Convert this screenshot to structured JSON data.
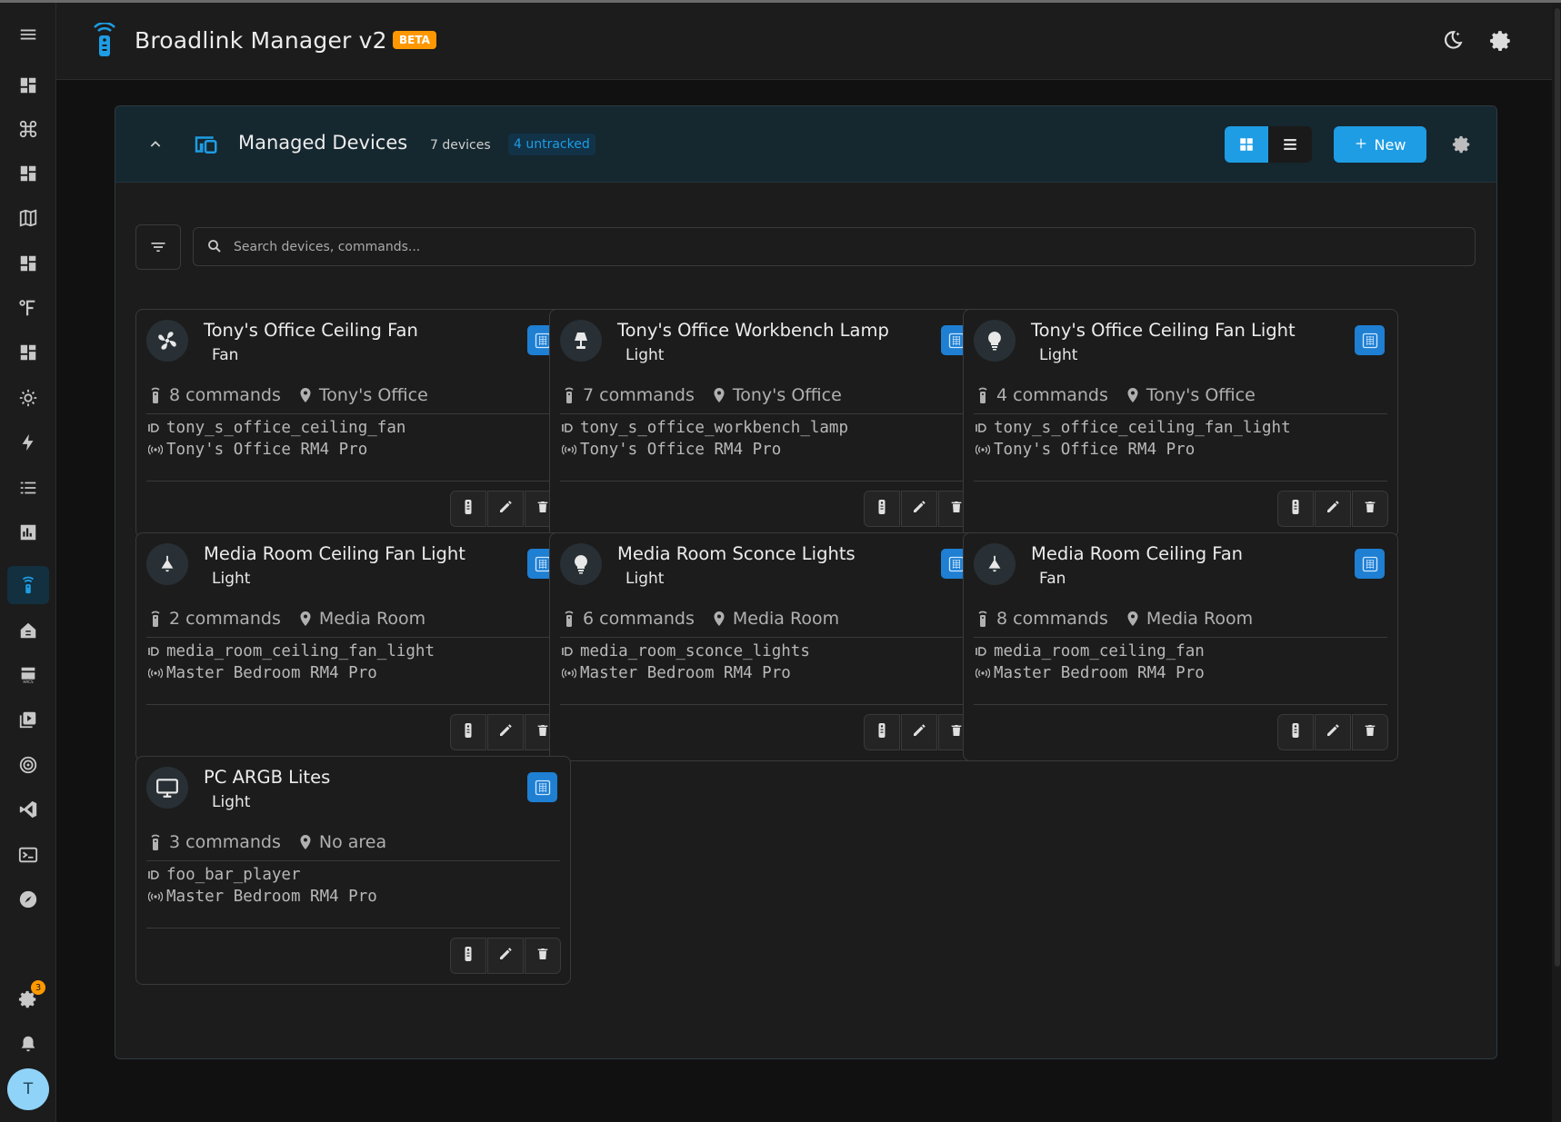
{
  "header": {
    "title": "Broadlink Manager v2",
    "beta_badge": "BETA"
  },
  "sidebar": {
    "items": [
      {
        "icon": "menu-icon"
      },
      {
        "icon": "dashboard-icon"
      },
      {
        "icon": "command-icon"
      },
      {
        "icon": "dashboard-icon"
      },
      {
        "icon": "map-icon"
      },
      {
        "icon": "dashboard-icon"
      },
      {
        "icon": "fahrenheit-icon"
      },
      {
        "icon": "dashboard-icon"
      },
      {
        "icon": "sun-icon"
      },
      {
        "icon": "lightning-icon"
      },
      {
        "icon": "list-icon"
      },
      {
        "icon": "bar-chart-icon"
      },
      {
        "icon": "remote-icon",
        "active": true
      },
      {
        "icon": "house-icon"
      },
      {
        "icon": "hacs-icon"
      },
      {
        "icon": "media-icon"
      },
      {
        "icon": "radar-icon"
      },
      {
        "icon": "vscode-icon"
      },
      {
        "icon": "terminal-icon"
      },
      {
        "icon": "compass-icon"
      }
    ],
    "settings_badge": "3",
    "avatar_initial": "T"
  },
  "panel": {
    "title": "Managed Devices",
    "device_count": "7 devices",
    "untracked_badge": "4 untracked",
    "new_button": "New",
    "view_mode": "grid",
    "search_placeholder": "Search devices, commands..."
  },
  "devices": [
    {
      "name": "Tony's Office Ceiling Fan",
      "type": "Fan",
      "icon": "fan-icon",
      "commands": "8 commands",
      "area": "Tony's Office",
      "entity": "tony_s_office_ceiling_fan",
      "remote": "Tony's Office RM4 Pro"
    },
    {
      "name": "Tony's Office Workbench Lamp",
      "type": "Light",
      "icon": "lamp-icon",
      "commands": "7 commands",
      "area": "Tony's Office",
      "entity": "tony_s_office_workbench_lamp",
      "remote": "Tony's Office RM4 Pro"
    },
    {
      "name": "Tony's Office Ceiling Fan Light",
      "type": "Light",
      "icon": "lightbulb-icon",
      "commands": "4 commands",
      "area": "Tony's Office",
      "entity": "tony_s_office_ceiling_fan_light",
      "remote": "Tony's Office RM4 Pro"
    },
    {
      "name": "Media Room Ceiling Fan Light",
      "type": "Light",
      "icon": "ceiling-light-icon",
      "commands": "2 commands",
      "area": "Media Room",
      "entity": "media_room_ceiling_fan_light",
      "remote": "Master Bedroom RM4 Pro"
    },
    {
      "name": "Media Room Sconce Lights",
      "type": "Light",
      "icon": "lightbulb-icon",
      "commands": "6 commands",
      "area": "Media Room",
      "entity": "media_room_sconce_lights",
      "remote": "Master Bedroom RM4 Pro"
    },
    {
      "name": "Media Room Ceiling Fan",
      "type": "Fan",
      "icon": "ceiling-light-icon",
      "commands": "8 commands",
      "area": "Media Room",
      "entity": "media_room_ceiling_fan",
      "remote": "Master Bedroom RM4 Pro"
    },
    {
      "name": "PC ARGB Lites",
      "type": "Light",
      "icon": "monitor-icon",
      "commands": "3 commands",
      "area": "No area",
      "entity": "foo_bar_player",
      "remote": "Master Bedroom RM4 Pro"
    }
  ],
  "colors": {
    "accent": "#1e9de4",
    "beta": "#ff9800",
    "tracked_badge": "#1e7fd3",
    "background": "#111111",
    "surface": "#1c1c1c"
  }
}
